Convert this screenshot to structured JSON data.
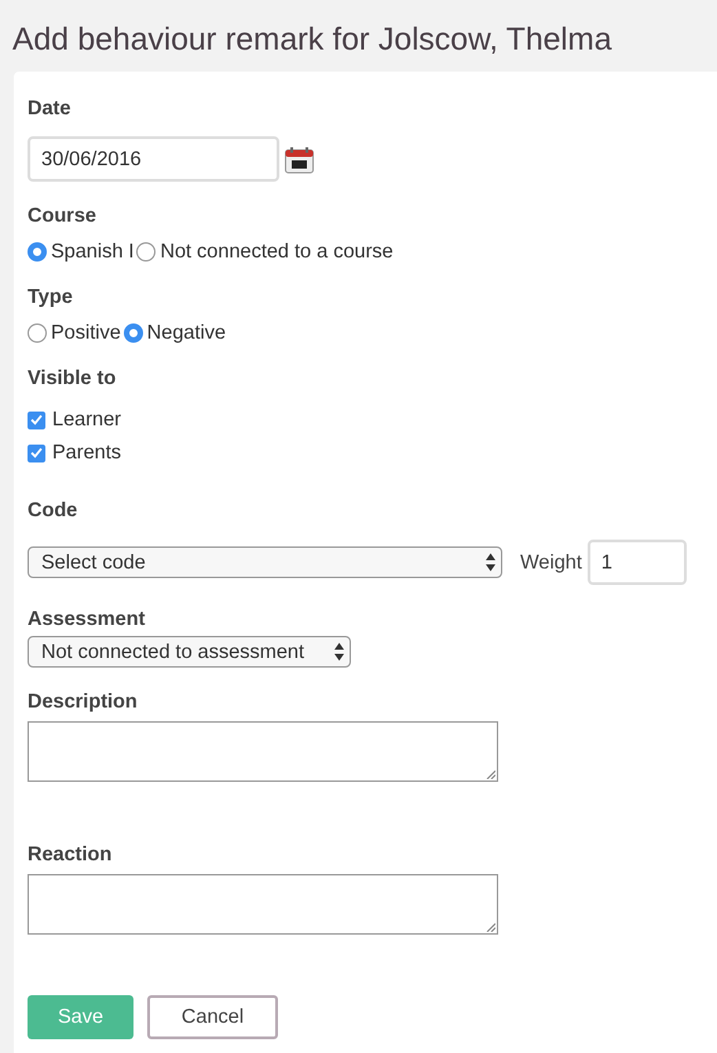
{
  "page_title": "Add behaviour remark for Jolscow, Thelma",
  "date": {
    "label": "Date",
    "value": "30/06/2016"
  },
  "course": {
    "label": "Course",
    "options": [
      {
        "label": "Spanish I",
        "selected": true
      },
      {
        "label": "Not connected to a course",
        "selected": false
      }
    ]
  },
  "type": {
    "label": "Type",
    "options": [
      {
        "label": "Positive",
        "selected": false
      },
      {
        "label": "Negative",
        "selected": true
      }
    ]
  },
  "visible_to": {
    "label": "Visible to",
    "options": [
      {
        "label": "Learner",
        "checked": true
      },
      {
        "label": "Parents",
        "checked": true
      }
    ]
  },
  "code": {
    "label": "Code",
    "value": "Select code"
  },
  "weight": {
    "label": "Weight",
    "value": "1"
  },
  "assessment": {
    "label": "Assessment",
    "value": "Not connected to assessment"
  },
  "description": {
    "label": "Description"
  },
  "reaction": {
    "label": "Reaction"
  },
  "buttons": [
    {
      "label": "Save",
      "kind": "primary"
    },
    {
      "label": "Cancel",
      "kind": "secondary"
    }
  ]
}
